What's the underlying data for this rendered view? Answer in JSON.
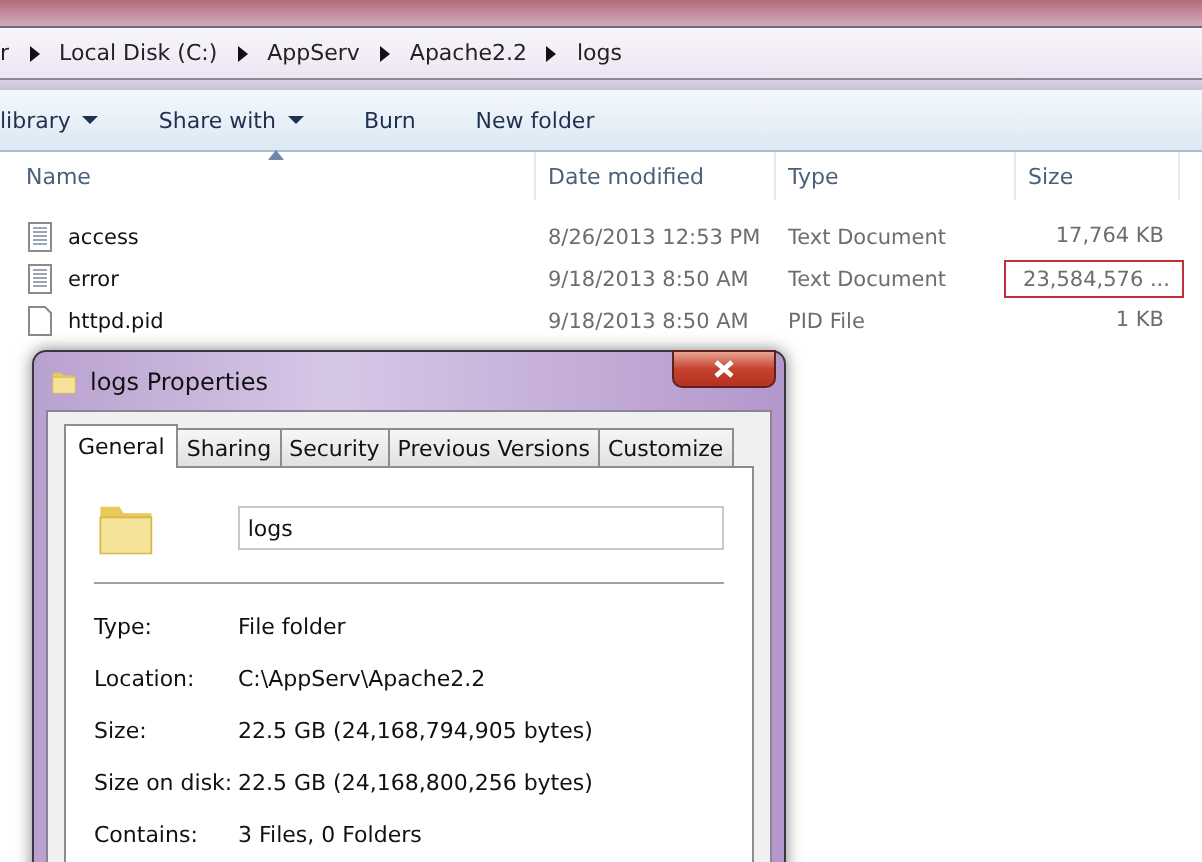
{
  "address_bar": {
    "crumbs": [
      "r",
      "Local Disk (C:)",
      "AppServ",
      "Apache2.2",
      "logs"
    ]
  },
  "toolbar": [
    {
      "label": "library",
      "dropdown": true
    },
    {
      "label": "Share with",
      "dropdown": true
    },
    {
      "label": "Burn",
      "dropdown": false
    },
    {
      "label": "New folder",
      "dropdown": false
    }
  ],
  "table": {
    "columns": [
      {
        "label": "Name",
        "sorted": true
      },
      {
        "label": "Date modified",
        "sorted": false
      },
      {
        "label": "Type",
        "sorted": false
      },
      {
        "label": "Size",
        "sorted": false
      }
    ],
    "rows": [
      {
        "name": "access",
        "date": "8/26/2013 12:53 PM",
        "type": "Text Document",
        "size": "17,764 KB",
        "kind": "text",
        "highlighted": false
      },
      {
        "name": "error",
        "date": "9/18/2013 8:50 AM",
        "type": "Text Document",
        "size": "23,584,576 ...",
        "kind": "text",
        "highlighted": true
      },
      {
        "name": "httpd.pid",
        "date": "9/18/2013 8:50 AM",
        "type": "PID File",
        "size": "1 KB",
        "kind": "blank",
        "highlighted": false
      }
    ]
  },
  "dialog": {
    "title": "logs Properties",
    "tabs": [
      {
        "label": "General",
        "selected": true
      },
      {
        "label": "Sharing",
        "selected": false
      },
      {
        "label": "Security",
        "selected": false
      },
      {
        "label": "Previous Versions",
        "selected": false
      },
      {
        "label": "Customize",
        "selected": false
      }
    ],
    "name_field": {
      "value": "logs"
    },
    "properties": [
      {
        "label": "Type:",
        "value": "File folder"
      },
      {
        "label": "Location:",
        "value": "C:\\AppServ\\Apache2.2"
      },
      {
        "label": "Size:",
        "value": "22.5 GB (24,168,794,905 bytes)"
      },
      {
        "label": "Size on disk:",
        "value": "22.5 GB (24,168,800,256 bytes)"
      },
      {
        "label": "Contains:",
        "value": "3 Files, 0 Folders"
      }
    ]
  }
}
